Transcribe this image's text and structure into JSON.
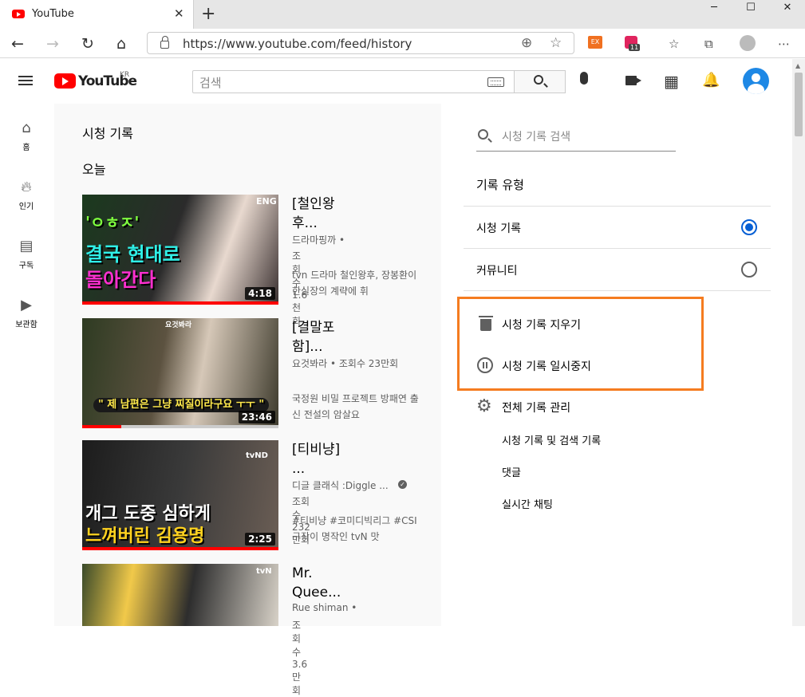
{
  "browser": {
    "tab_title": "YouTube",
    "url": "https://www.youtube.com/feed/history",
    "ext_badge_count": "11",
    "ext_label": "EX"
  },
  "header": {
    "logo_text": "YouTube",
    "logo_region": "KR",
    "search_placeholder": "검색"
  },
  "sidebar": {
    "items": [
      {
        "label": "홈",
        "icon": "home-icon"
      },
      {
        "label": "인기",
        "icon": "fire-icon"
      },
      {
        "label": "구독",
        "icon": "subscriptions-icon"
      },
      {
        "label": "보관함",
        "icon": "library-icon"
      }
    ]
  },
  "main": {
    "title": "시청 기록",
    "section": "오늘",
    "videos": [
      {
        "title": "[철인왕후...",
        "channel": "드라마핑까 •",
        "views": "조회수 1.6천회",
        "desc": "tvn 드라마 철인왕후, 장봉환이 한실장의 계략에 휘",
        "duration": "4:18",
        "thumb_text": [
          "'ㅇㅎㅈ'",
          "결국 현대로",
          "돌아간다"
        ],
        "thumb_badge": "ENG",
        "progress": 1.0
      },
      {
        "title": "[결말포함]...",
        "channel": "요것봐라 • 조회수 23만회",
        "views": "",
        "desc": "국정원 비밀 프로젝트 방패연 출신 전설의 암살요",
        "duration": "23:46",
        "thumb_text": [
          "\" 제 남편은 그냥 찌질이라구요 ㅜㅜ \""
        ],
        "thumb_badge": "요것봐라",
        "progress": 0.2
      },
      {
        "title": "[티비냥] ...",
        "channel": "디글 클래식 :Diggle ...",
        "views": "조회수 232만회",
        "desc": "#티비냥 #코미디빅리그 #CSI 구작이 명작인 tvN 맛",
        "duration": "2:25",
        "thumb_text": [
          "개그 도중 심하게",
          "느껴버린 김용명"
        ],
        "thumb_badge": "tvND",
        "progress": 1.0
      },
      {
        "title": "Mr. Quee...",
        "channel": "Rue shiman •",
        "views": "조회수 3.6만회",
        "desc": "",
        "duration": "",
        "thumb_text": [],
        "thumb_badge": "tvN",
        "progress": 0
      }
    ]
  },
  "panel": {
    "search_placeholder": "시청 기록 검색",
    "type_heading": "기록 유형",
    "options": [
      {
        "label": "시청 기록",
        "selected": true
      },
      {
        "label": "커뮤니티",
        "selected": false
      }
    ],
    "actions": {
      "clear": "시청 기록 지우기",
      "pause": "시청 기록 일시중지",
      "manage": "전체 기록 관리"
    },
    "links": [
      "시청 기록 및 검색 기록",
      "댓글",
      "실시간 채팅"
    ],
    "highlight_color": "#f57c20"
  }
}
